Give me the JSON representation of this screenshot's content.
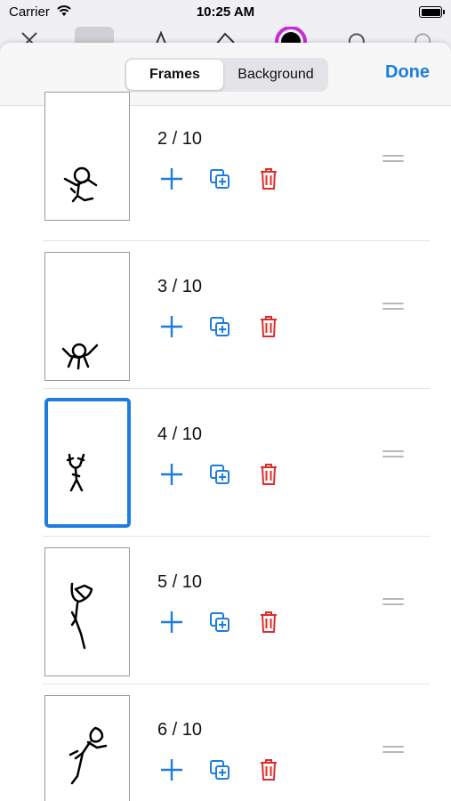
{
  "status_bar": {
    "carrier": "Carrier",
    "time": "10:25 AM"
  },
  "sheet": {
    "segments": [
      "Frames",
      "Background"
    ],
    "selected_segment": "Frames",
    "done_label": "Done"
  },
  "frames": [
    {
      "label": "2 / 10",
      "selected": false
    },
    {
      "label": "3 / 10",
      "selected": false
    },
    {
      "label": "4 / 10",
      "selected": true
    },
    {
      "label": "5 / 10",
      "selected": false
    },
    {
      "label": "6 / 10",
      "selected": false
    }
  ],
  "colors": {
    "accent": "#1c7ddf",
    "delete": "#e02b2b",
    "grip": "#b8b8b8"
  }
}
